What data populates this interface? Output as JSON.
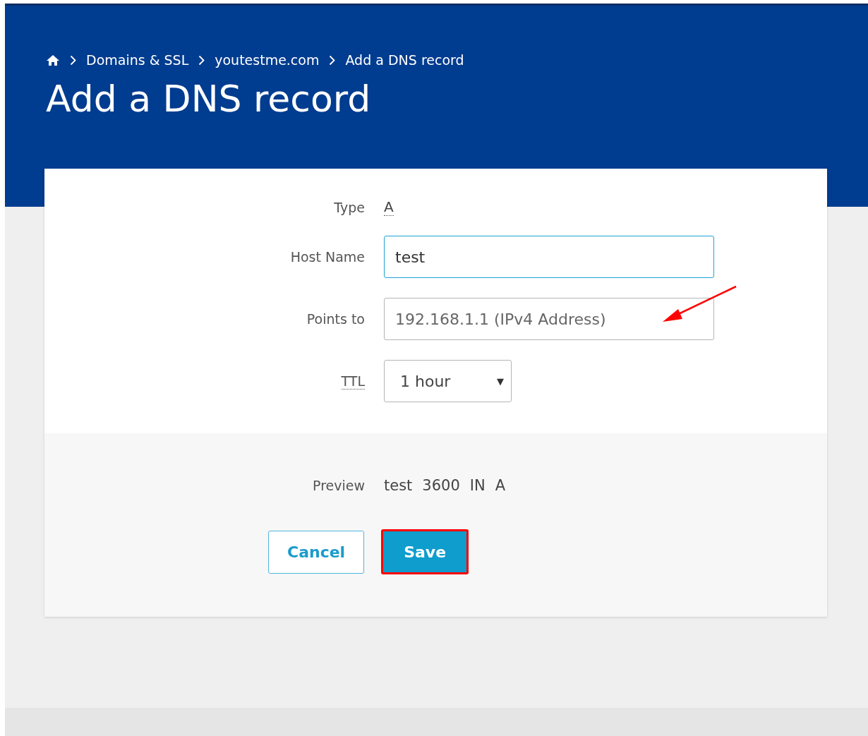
{
  "breadcrumbs": [
    {
      "label": "Domains & SSL"
    },
    {
      "label": "youtestme.com"
    },
    {
      "label": "Add a DNS record"
    }
  ],
  "title": "Add a DNS record",
  "form": {
    "type": {
      "label": "Type",
      "value": "A"
    },
    "host_name": {
      "label": "Host Name",
      "value": "test",
      "focused": true
    },
    "points_to": {
      "label": "Points to",
      "placeholder": "192.168.1.1 (IPv4 Address)",
      "focused": false,
      "annotated": true
    },
    "ttl": {
      "label": "TTL",
      "value": "1 hour",
      "arrow": "▼"
    }
  },
  "preview": {
    "label": "Preview",
    "tokens": [
      "test",
      "3600",
      "IN",
      "A"
    ]
  },
  "buttons": [
    {
      "kind": "secondary",
      "label": "Cancel",
      "highlighted": false
    },
    {
      "kind": "primary",
      "label": "Save",
      "highlighted": true
    }
  ]
}
